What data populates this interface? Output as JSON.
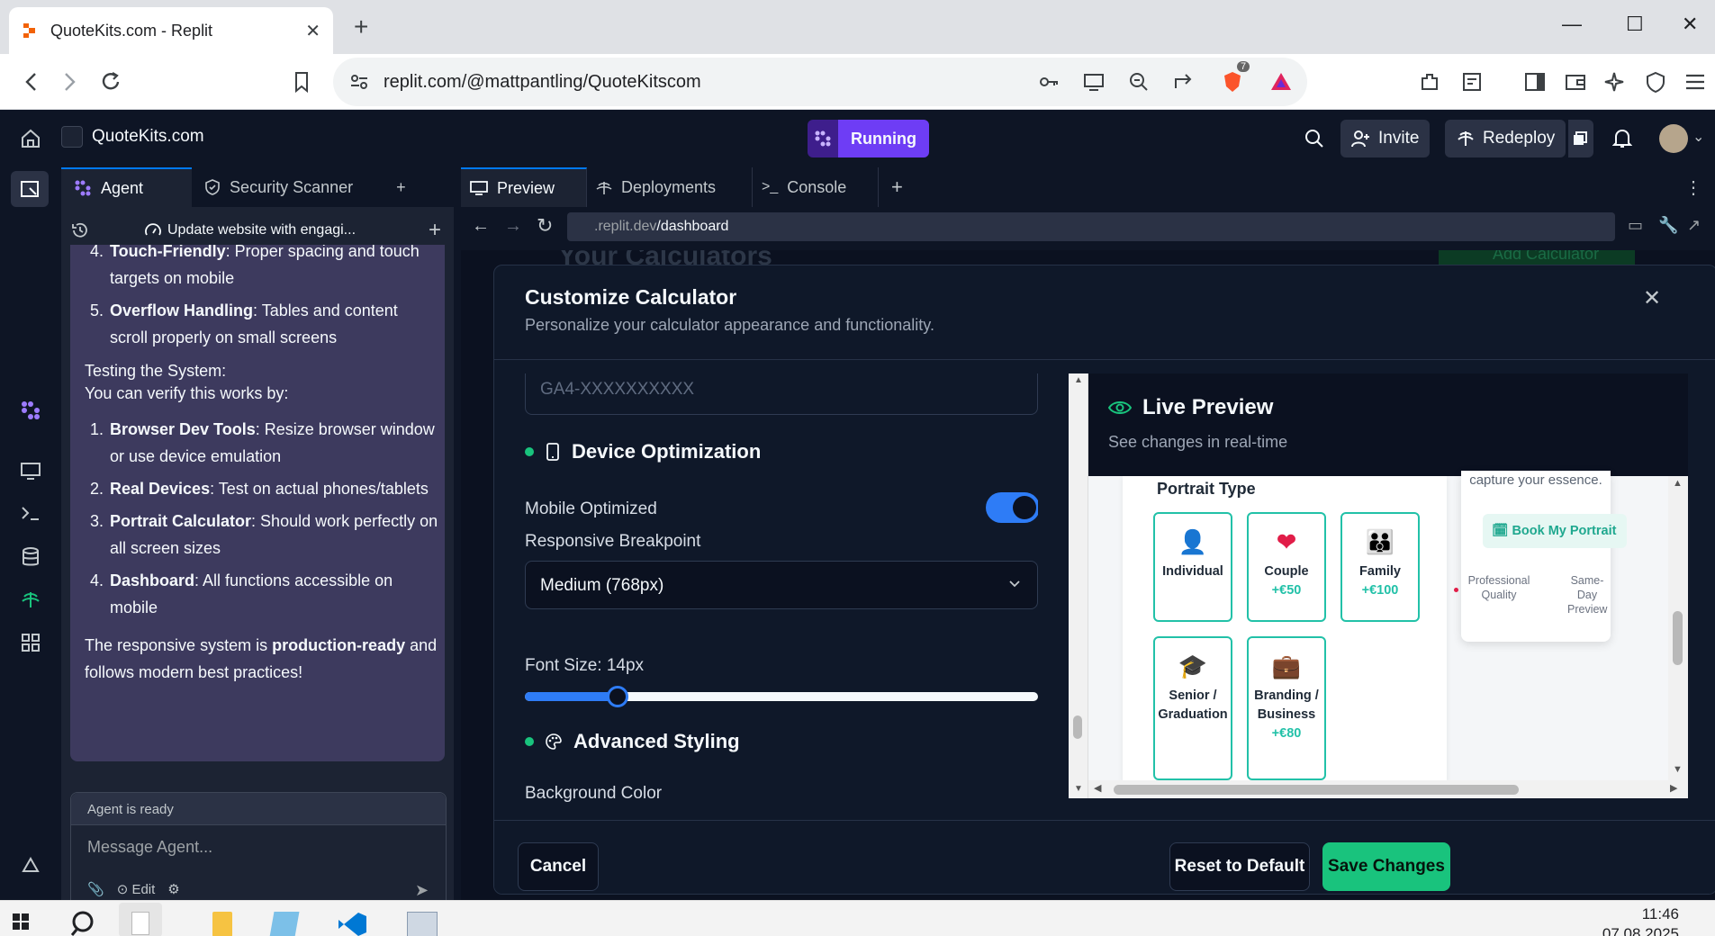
{
  "browser": {
    "tab_title": "QuoteKits.com - Replit",
    "url": "replit.com/@mattpantling/QuoteKitscom",
    "extension_badge": "7"
  },
  "replit": {
    "project_name": "QuoteKits.com",
    "run_status": "Running",
    "invite_label": "Invite",
    "redeploy_label": "Redeploy"
  },
  "agent_panel": {
    "tabs": [
      {
        "label": "Agent"
      },
      {
        "label": "Security Scanner"
      }
    ],
    "thread_title": "Update website with engagi...",
    "message": {
      "list1": [
        {
          "bold": "Touch-Friendly",
          "text": ": Proper spacing and touch targets on mobile"
        },
        {
          "bold": "Overflow Handling",
          "text": ": Tables and content scroll properly on small screens"
        }
      ],
      "testing_heading": "Testing the System:",
      "testing_intro": "You can verify this works by:",
      "list2": [
        {
          "bold": "Browser Dev Tools",
          "text": ": Resize browser window or use device emulation"
        },
        {
          "bold": "Real Devices",
          "text": ": Test on actual phones/tablets"
        },
        {
          "bold": "Portrait Calculator",
          "text": ": Should work perfectly on all screen sizes"
        },
        {
          "bold": "Dashboard",
          "text": ": All functions accessible on mobile"
        }
      ],
      "closing_pre": "The responsive system is ",
      "closing_bold": "production-ready",
      "closing_post": " and follows modern best practices!"
    },
    "composer": {
      "status": "Agent is ready",
      "placeholder": "Message Agent...",
      "edit_label": "Edit"
    }
  },
  "preview": {
    "tabs": [
      {
        "label": "Preview"
      },
      {
        "label": "Deployments"
      },
      {
        "label": "Console"
      }
    ],
    "url_prefix": ".replit.dev",
    "url_path": "/dashboard",
    "background_title": "Your Calculators",
    "background_button": "Add Calculator"
  },
  "modal": {
    "title": "Customize Calculator",
    "subtitle": "Personalize your calculator appearance and functionality.",
    "ga_placeholder": "GA4-XXXXXXXXXX",
    "device_section": "Device Optimization",
    "mobile_optimized_label": "Mobile Optimized",
    "mobile_optimized": true,
    "breakpoint_label": "Responsive Breakpoint",
    "breakpoint_value": "Medium (768px)",
    "font_size_label": "Font Size: 14px",
    "font_size_fraction": 0.18,
    "advanced_section": "Advanced Styling",
    "cut_label": "Background Color",
    "cancel_label": "Cancel",
    "reset_label": "Reset to Default",
    "save_label": "Save Changes"
  },
  "live_preview": {
    "title": "Live Preview",
    "subtitle": "See changes in real-time",
    "portrait_type_label": "Portrait Type",
    "options": [
      {
        "name": "Individual",
        "price": "",
        "icon": "person"
      },
      {
        "name": "Couple",
        "price": "+€50",
        "icon": "heart"
      },
      {
        "name": "Family",
        "price": "+€100",
        "icon": "family"
      },
      {
        "name": "Senior / Graduation",
        "price": "",
        "icon": "graduation-cap"
      },
      {
        "name": "Branding / Business",
        "price": "+€80",
        "icon": "briefcase"
      }
    ],
    "side_caption": "capture your essence.",
    "book_label": "Book My Portrait",
    "quality_label": "Professional Quality",
    "sameday_label": "Same-Day Preview"
  },
  "taskbar": {
    "time": "11:46",
    "date": "07.08.2025"
  },
  "colors": {
    "accent_blue": "#0079f2",
    "running_purple": "#6e3df5",
    "save_green": "#19c37d",
    "teal": "#22c1a8"
  }
}
